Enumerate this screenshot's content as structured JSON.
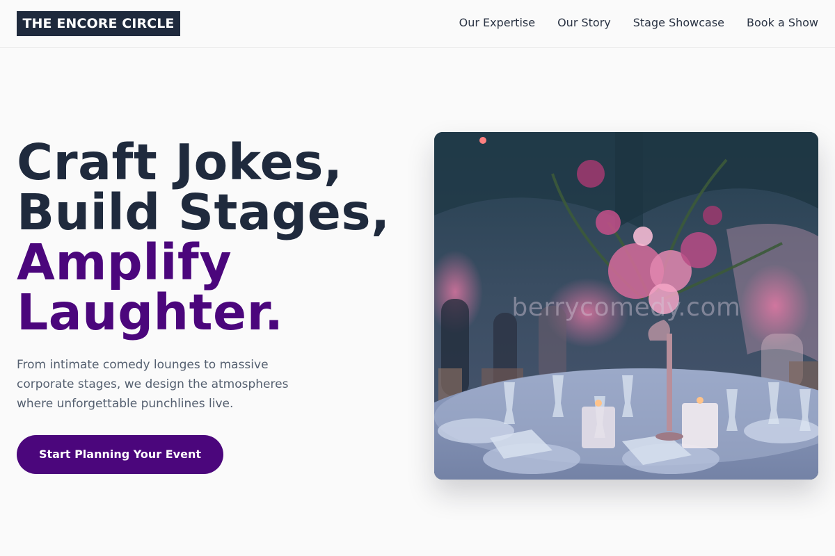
{
  "brand": {
    "logo_text": "THE ENCORE CIRCLE"
  },
  "nav": {
    "items": [
      {
        "label": "Our Expertise"
      },
      {
        "label": "Our Story"
      },
      {
        "label": "Stage Showcase"
      },
      {
        "label": "Book a Show"
      }
    ]
  },
  "hero": {
    "title_line1": "Craft Jokes,",
    "title_line2": "Build Stages,",
    "title_line3": "Amplify",
    "title_line4": "Laughter.",
    "subtitle": "From intimate comedy lounges to massive corporate stages, we design the atmospheres where unforgettable punchlines live.",
    "cta_label": "Start Planning Your Event",
    "image_watermark": "berrycomedy.com"
  },
  "colors": {
    "brand_dark": "#1f2a3d",
    "accent_purple": "#4b067c",
    "background": "#fafafa",
    "body_text": "#556070"
  },
  "icons": {
    "hero_image": "event-table-photo"
  }
}
